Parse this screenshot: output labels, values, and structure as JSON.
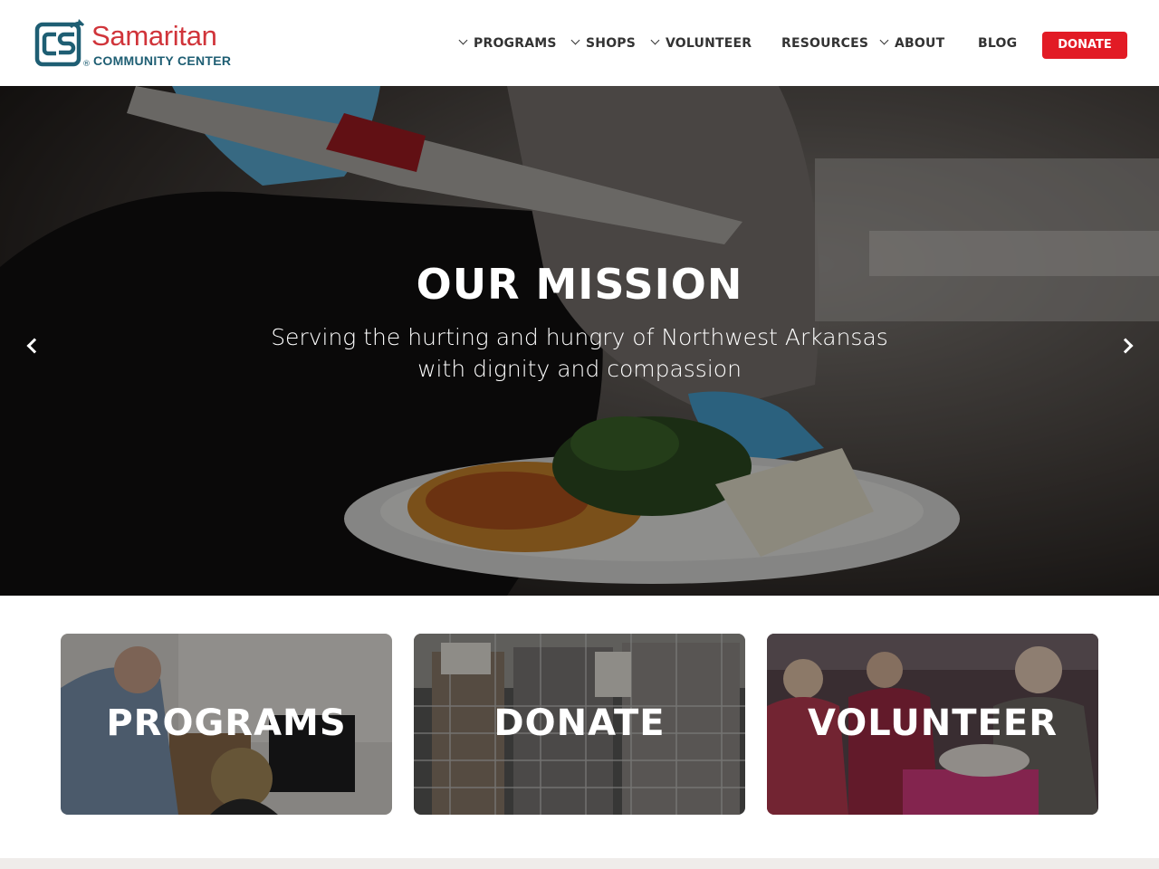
{
  "brand": {
    "name": "Samaritan",
    "registered": "®",
    "subtitle": "COMMUNITY CENTER",
    "colors": {
      "red": "#d0343a",
      "teal": "#1e5e73"
    }
  },
  "nav": {
    "items": [
      {
        "label": "PROGRAMS",
        "dropdown": true
      },
      {
        "label": "SHOPS",
        "dropdown": true
      },
      {
        "label": "VOLUNTEER",
        "dropdown": true
      },
      {
        "label": "RESOURCES",
        "dropdown": false
      },
      {
        "label": "ABOUT",
        "dropdown": true
      },
      {
        "label": "BLOG",
        "dropdown": false
      }
    ],
    "donate_label": "DONATE",
    "donate_color": "#e21b25"
  },
  "hero": {
    "title": "OUR MISSION",
    "subtitle": "Serving the hurting and hungry of Northwest Arkansas with dignity and compassion",
    "prev_icon": "chevron-left-icon",
    "next_icon": "chevron-right-icon"
  },
  "cards": [
    {
      "label": "PROGRAMS"
    },
    {
      "label": "DONATE"
    },
    {
      "label": "VOLUNTEER"
    }
  ]
}
